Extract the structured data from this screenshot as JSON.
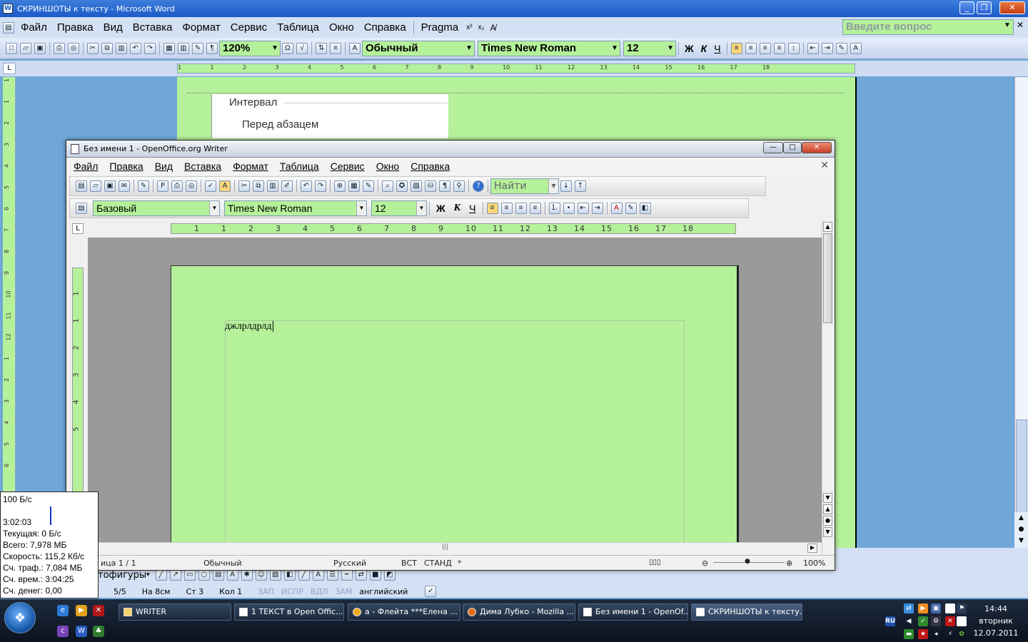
{
  "word": {
    "title": "СКРИНШОТЫ к тексту - Microsoft Word",
    "menu": [
      "Файл",
      "Правка",
      "Вид",
      "Вставка",
      "Формат",
      "Сервис",
      "Таблица",
      "Окно",
      "Справка",
      "Pragma"
    ],
    "ask_placeholder": "Введите вопрос",
    "zoom": "120%",
    "style": "Обычный",
    "font": "Times New Roman",
    "size": "12",
    "bold": "Ж",
    "italic": "К",
    "underline": "Ч",
    "ruler_numbers": [
      "1",
      "1",
      "2",
      "3",
      "4",
      "5",
      "6",
      "7",
      "8",
      "9",
      "10",
      "11",
      "12",
      "13",
      "14",
      "15",
      "16",
      "17",
      "18"
    ],
    "vruler_numbers": [
      "1",
      "1",
      "2",
      "3",
      "4",
      "5",
      "6",
      "7",
      "8",
      "9",
      "10",
      "11",
      "12",
      "1",
      "2",
      "3",
      "4",
      "5",
      "6"
    ],
    "dialog": {
      "group": "Интервал",
      "before": "Перед абзацем"
    },
    "draw_toolbar": "тофигуры",
    "status": {
      "page": "5/5",
      "at": "На 8см",
      "line": "Ст 3",
      "col": "Кол 1",
      "rec": "ЗАП",
      "trk": "ИСПР",
      "ext": "ВДЛ",
      "ovr": "ЗАМ",
      "lang": "английский"
    }
  },
  "writer": {
    "title": "Без имени 1 - OpenOffice.org Writer",
    "menu": [
      "Файл",
      "Правка",
      "Вид",
      "Вставка",
      "Формат",
      "Таблица",
      "Сервис",
      "Окно",
      "Справка"
    ],
    "find_placeholder": "Найти",
    "style": "Базовый",
    "font": "Times New Roman",
    "size": "12",
    "bold": "Ж",
    "italic": "К",
    "underline": "Ч",
    "ruler_numbers": [
      "1",
      "1",
      "2",
      "3",
      "4",
      "5",
      "6",
      "7",
      "8",
      "9",
      "10",
      "11",
      "12",
      "13",
      "14",
      "15",
      "16",
      "17",
      "18"
    ],
    "vruler_numbers": [
      "1",
      "1",
      "2",
      "3",
      "4",
      "5"
    ],
    "document_text": "джлрлдрлд",
    "status": {
      "page": "ица  1 / 1",
      "style": "Обычный",
      "lang": "Русский",
      "ins": "ВСТ",
      "sel": "СТАНД",
      "mod": "*",
      "zoom": "100%"
    }
  },
  "netmeter": {
    "rate": "100 Б/с",
    "time": "3:02:03",
    "current": "Текущая: 0 Б/с",
    "total": "Всего: 7,978 МБ",
    "speed_label": "Скорость: ",
    "speed_value": "115,2 Кб/с",
    "traffic": "Сч. траф.: 7,084 МБ",
    "elapsed": "Сч. врем.: 3:04:25",
    "money": "Сч. денег: 0,00"
  },
  "taskbar": {
    "tasks": [
      {
        "label": "WRITER",
        "icon": "folder-icon"
      },
      {
        "label": "1 ТЕКСТ в Open Offic...",
        "icon": "word-icon"
      },
      {
        "label": "a - Флейта ***Елена ...",
        "icon": "player-icon"
      },
      {
        "label": "Дима Лубко - Mozilla ...",
        "icon": "firefox-icon"
      },
      {
        "label": "Без имени 1 - OpenOf...",
        "icon": "writer-icon"
      },
      {
        "label": "СКРИНШОТЫ к тексту...",
        "icon": "word-icon"
      }
    ],
    "lang": "RU",
    "time": "14:44",
    "day": "вторник",
    "date": "12.07.2011"
  }
}
